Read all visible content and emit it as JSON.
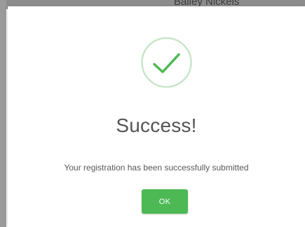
{
  "background": {
    "partial_name_text": "Bailey Nickels"
  },
  "dialog": {
    "icon": "checkmark-circle-icon",
    "title": "Success!",
    "message": "Your registration has been successfully submitted",
    "ok_button_label": "OK",
    "colors": {
      "accent": "#4cb955",
      "icon_ring": "#c8e6c9",
      "title_text": "#545454"
    }
  }
}
